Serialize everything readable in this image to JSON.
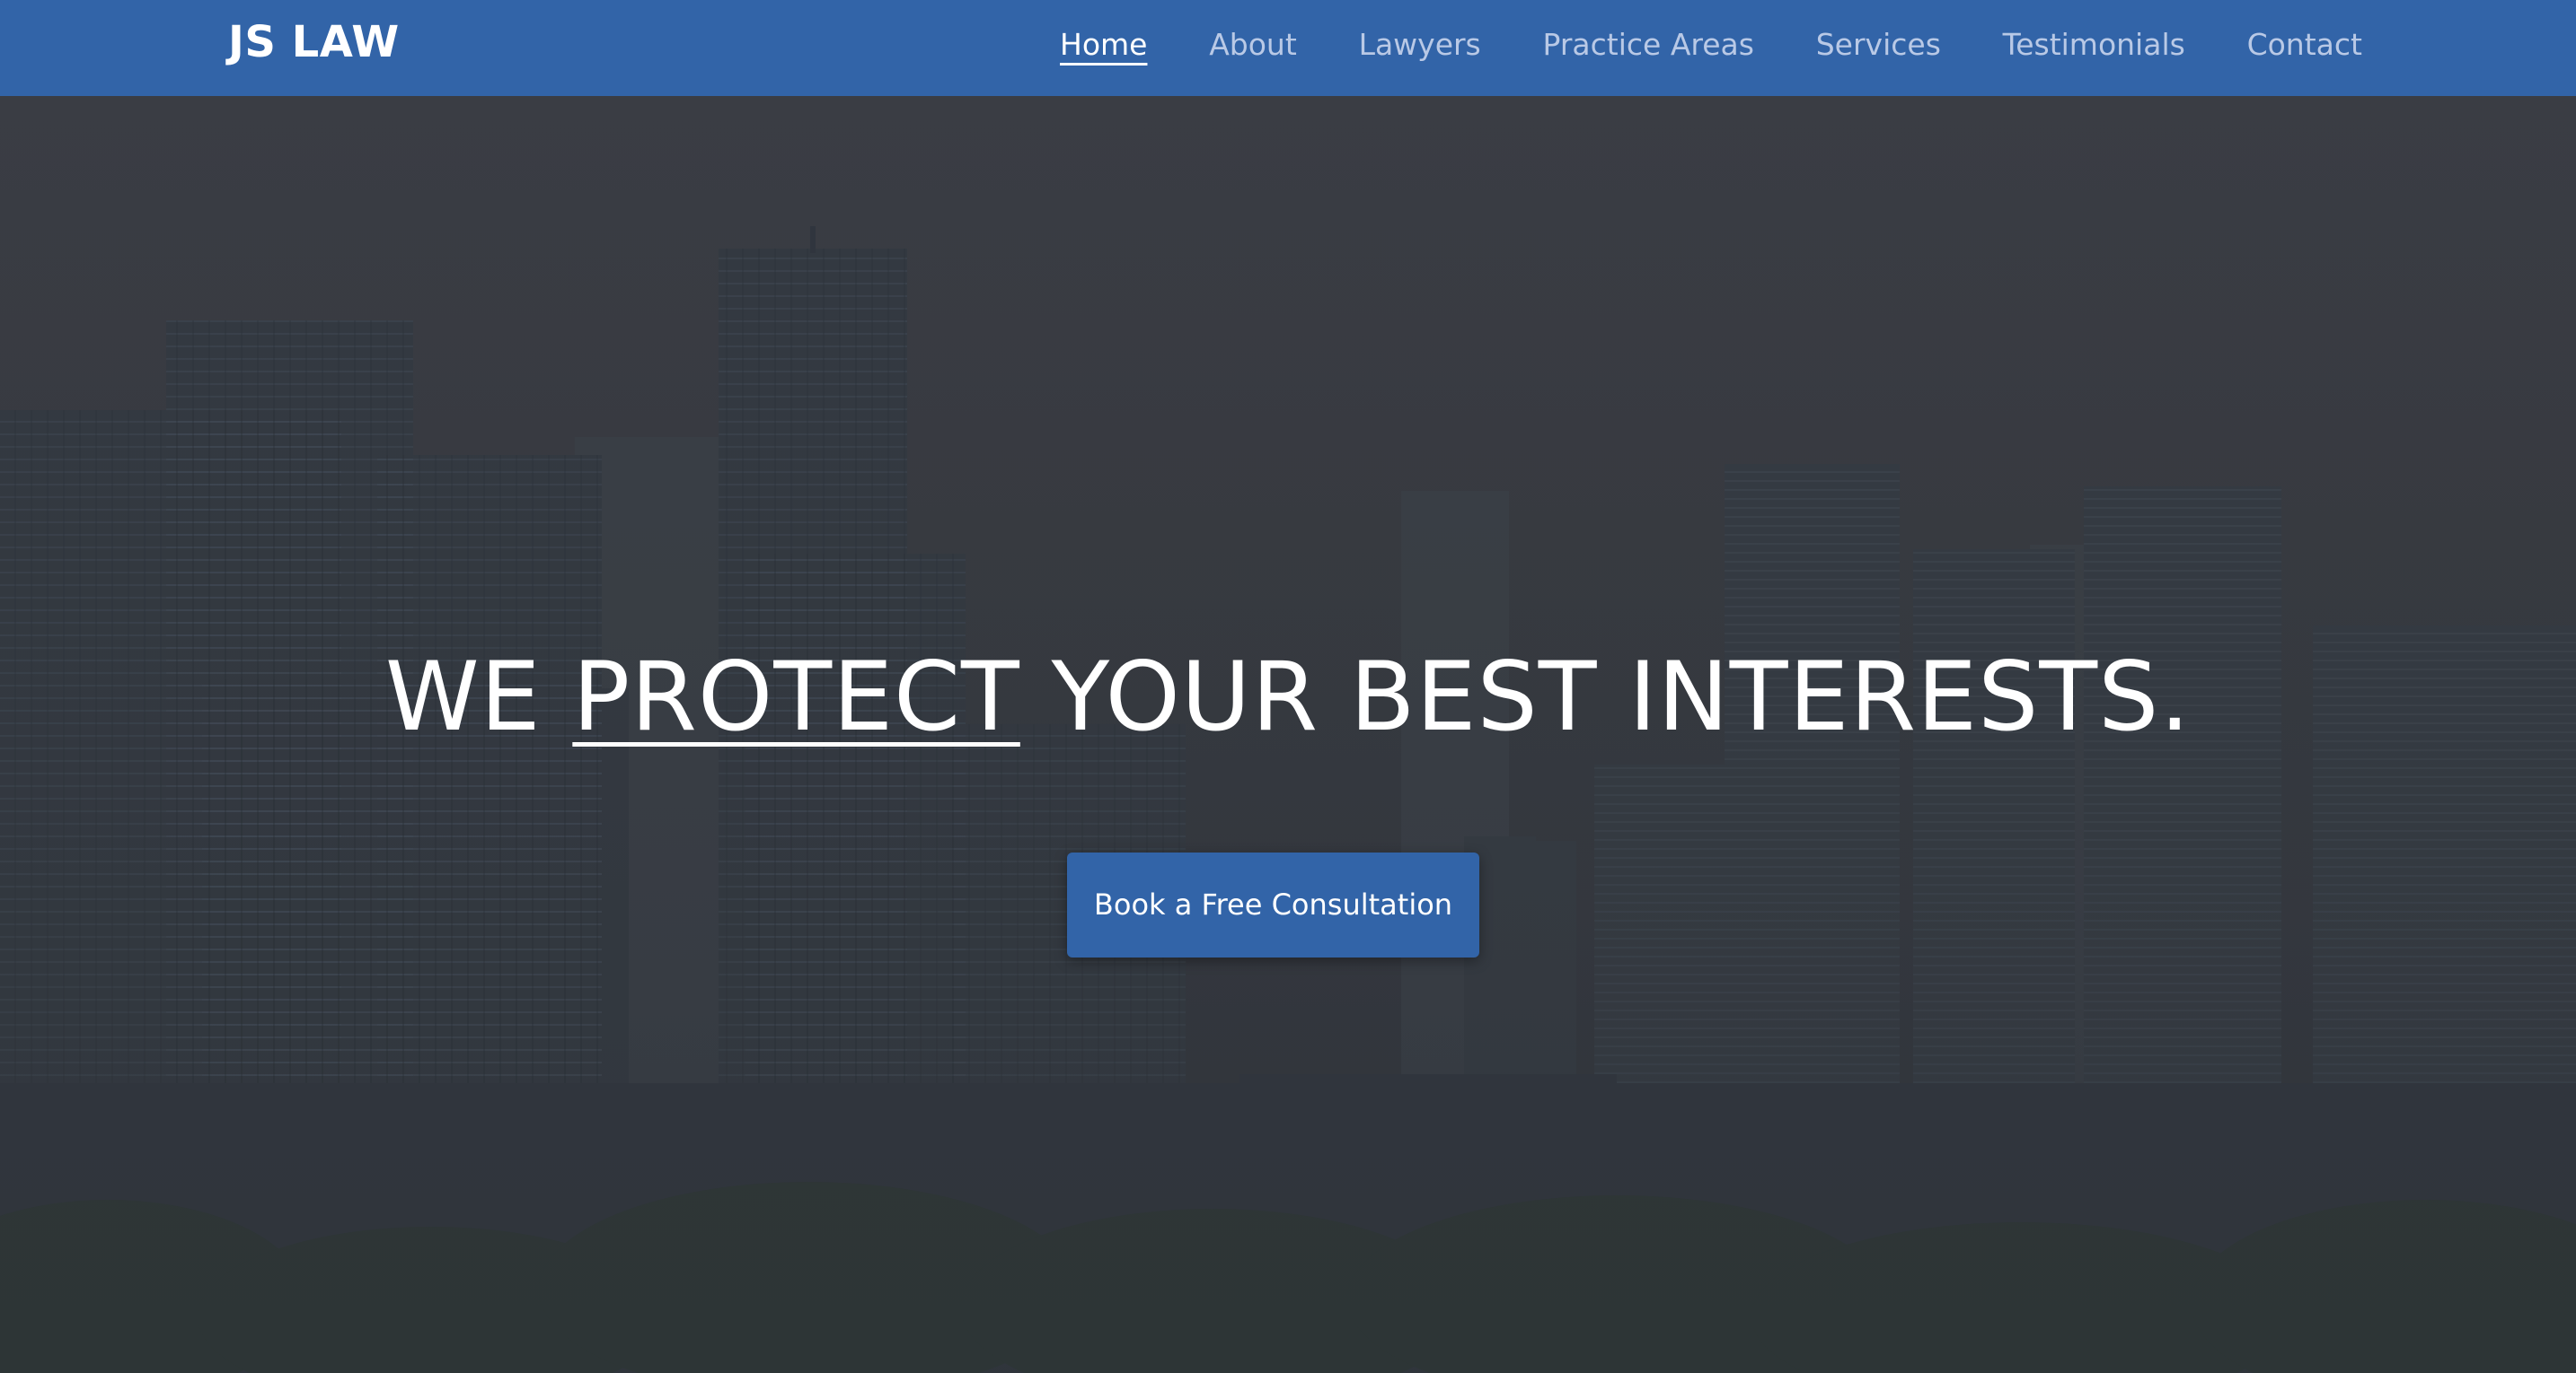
{
  "brand": {
    "name": "JS LAW"
  },
  "nav": {
    "items": [
      {
        "label": "Home",
        "active": true
      },
      {
        "label": "About",
        "active": false
      },
      {
        "label": "Lawyers",
        "active": false
      },
      {
        "label": "Practice Areas",
        "active": false
      },
      {
        "label": "Services",
        "active": false
      },
      {
        "label": "Testimonials",
        "active": false
      },
      {
        "label": "Contact",
        "active": false
      }
    ]
  },
  "hero": {
    "headline_before": "WE ",
    "headline_emphasis": "PROTECT",
    "headline_after": " YOUR BEST INTERESTS.",
    "cta_label": "Book a Free Consultation",
    "background": "city skyline"
  },
  "colors": {
    "primary": "#3264a8",
    "nav_link": "#b9c9e6",
    "text_light": "#ffffff",
    "hero_overlay": "#3b3d44"
  }
}
